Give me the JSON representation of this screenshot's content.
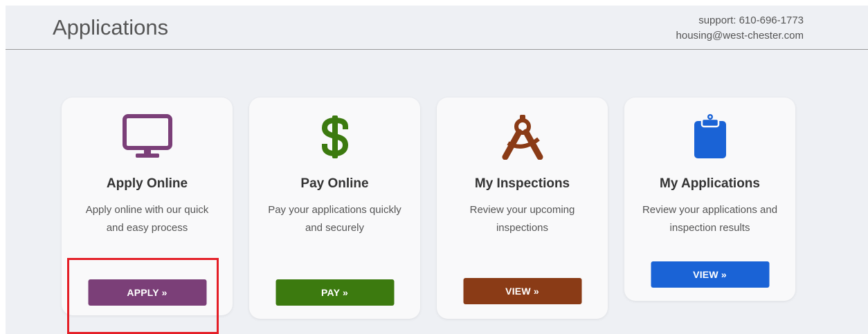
{
  "header": {
    "title": "Applications",
    "support_phone": "support: 610-696-1773",
    "support_email": "housing@west-chester.com"
  },
  "cards": [
    {
      "icon": "monitor-icon",
      "title": "Apply Online",
      "desc_line1": "Apply online with our quick",
      "desc_line2": "and easy process",
      "button": "APPLY »",
      "color": "#7b3f78"
    },
    {
      "icon": "dollar-icon",
      "title": "Pay Online",
      "desc_line1": "Pay your applications quickly",
      "desc_line2": "and securely",
      "button": "PAY »",
      "color": "#3c7a0f"
    },
    {
      "icon": "compass-icon",
      "title": "My Inspections",
      "desc_line1": "Review your upcoming",
      "desc_line2": "inspections",
      "button": "VIEW »",
      "color": "#8a3b16"
    },
    {
      "icon": "clipboard-icon",
      "title": "My Applications",
      "desc_line1": "Review your applications and",
      "desc_line2": "inspection results",
      "button": "VIEW »",
      "color": "#1a63d6"
    }
  ],
  "colors": {
    "background": "#eef0f4",
    "card": "#f9f9fa",
    "highlight": "#e41e26"
  }
}
